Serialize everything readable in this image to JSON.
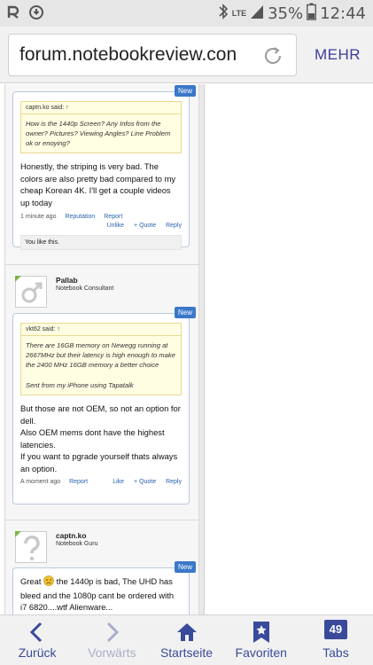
{
  "status_bar": {
    "network": "LTE",
    "battery": "35%",
    "time": "12:44"
  },
  "browser": {
    "url": "forum.notebookreview.con",
    "more_label": "MEHR"
  },
  "posts": [
    {
      "new_label": "New",
      "quote_author": "captn.ko said: ↑",
      "quote_text": "How is the 1440p Screen? Any Infos from the owner? Pictures? Viewing Angles? Line Problem ok or enoying?",
      "message": "Honestly, the striping is very bad. The colors are also pretty bad compared to my cheap Korean 4K. I'll get a couple videos up today",
      "time": "1 minute ago",
      "reputation": "Reputation",
      "report": "Report",
      "actions": [
        "Unlike",
        "+ Quote",
        "Reply"
      ],
      "likes": "You like this."
    },
    {
      "user": {
        "name": "Pallab",
        "title": "Notebook Consultant"
      },
      "new_label": "New",
      "quote_author": "vkt62 said: ↑",
      "quote_text": "There are 16GB memory on Newegg running at 2667MHz but their latency is high enough to make the 2400 MHz 16GB memory a better choice",
      "quote_signature": "Sent from my iPhone using Tapatalk",
      "message_lines": [
        "But those are not OEM, so not an option for dell.",
        "Also OEM mems dont have the highest latencies.",
        "If you want to pgrade yourself thats always an option."
      ],
      "time": "A moment ago",
      "report": "Report",
      "actions": [
        "Like",
        "+ Quote",
        "Reply"
      ]
    },
    {
      "user": {
        "name": "captn.ko",
        "title": "Notebook Guru"
      },
      "new_label": "New",
      "message_pre": "Great",
      "message_post": "the 1440p is bad, The UHD has bleed and the 1080p cant be ordered with i7 6820....wtf Alienware..."
    }
  ],
  "bottom_nav": {
    "back": "Zurück",
    "forward": "Vorwärts",
    "home": "Startseite",
    "favorites": "Favoriten",
    "tabs": "Tabs",
    "tabs_count": "49"
  },
  "colors": {
    "nav_accent": "#3a4a9a",
    "new_badge": "#3a78c9",
    "quote_bg": "#fffde2"
  }
}
